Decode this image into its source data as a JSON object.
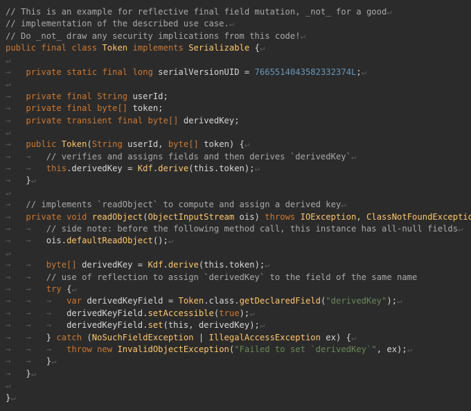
{
  "editor": {
    "lines": [
      [
        {
          "t": "// This is an example for reflective final field mutation, _not_ for a good",
          "c": "comment"
        },
        {
          "t": "↵",
          "c": "eol"
        }
      ],
      [
        {
          "t": "// implementation of the described use case.",
          "c": "comment"
        },
        {
          "t": "↵",
          "c": "eol"
        }
      ],
      [
        {
          "t": "// Do _not_ draw any security implications from this code!",
          "c": "comment"
        },
        {
          "t": "↵",
          "c": "eol"
        }
      ],
      [
        {
          "t": "public ",
          "c": "kw"
        },
        {
          "t": "final ",
          "c": "kw"
        },
        {
          "t": "class ",
          "c": "kw"
        },
        {
          "t": "Token",
          "c": "type"
        },
        {
          "t": " implements ",
          "c": "kw"
        },
        {
          "t": "Serializable",
          "c": "type"
        },
        {
          "t": " {",
          "c": "plain"
        },
        {
          "t": "↵",
          "c": "eol"
        }
      ],
      [
        {
          "t": "↵",
          "c": "eol"
        }
      ],
      [
        {
          "t": "→   ",
          "c": "tab"
        },
        {
          "t": "private ",
          "c": "kw"
        },
        {
          "t": "static ",
          "c": "kw"
        },
        {
          "t": "final ",
          "c": "kw"
        },
        {
          "t": "long ",
          "c": "kw"
        },
        {
          "t": "serialVersionUID = ",
          "c": "plain"
        },
        {
          "t": "7665514043582332374L",
          "c": "num"
        },
        {
          "t": ";",
          "c": "plain"
        },
        {
          "t": "↵",
          "c": "eol"
        }
      ],
      [
        {
          "t": "↵",
          "c": "eol"
        }
      ],
      [
        {
          "t": "→   ",
          "c": "tab"
        },
        {
          "t": "private ",
          "c": "kw"
        },
        {
          "t": "final ",
          "c": "kw"
        },
        {
          "t": "String ",
          "c": "kw"
        },
        {
          "t": "userId;",
          "c": "plain"
        }
      ],
      [
        {
          "t": "→   ",
          "c": "tab"
        },
        {
          "t": "private ",
          "c": "kw"
        },
        {
          "t": "final ",
          "c": "kw"
        },
        {
          "t": "byte[] ",
          "c": "kw"
        },
        {
          "t": "token;",
          "c": "plain"
        }
      ],
      [
        {
          "t": "→   ",
          "c": "tab"
        },
        {
          "t": "private ",
          "c": "kw"
        },
        {
          "t": "transient ",
          "c": "kw"
        },
        {
          "t": "final ",
          "c": "kw"
        },
        {
          "t": "byte[] ",
          "c": "kw"
        },
        {
          "t": "derivedKey;",
          "c": "plain"
        }
      ],
      [
        {
          "t": "↵",
          "c": "eol"
        }
      ],
      [
        {
          "t": "→   ",
          "c": "tab"
        },
        {
          "t": "public ",
          "c": "kw"
        },
        {
          "t": "Token",
          "c": "type"
        },
        {
          "t": "(",
          "c": "plain"
        },
        {
          "t": "String ",
          "c": "kw"
        },
        {
          "t": "userId, ",
          "c": "plain"
        },
        {
          "t": "byte[] ",
          "c": "kw"
        },
        {
          "t": "token) {",
          "c": "plain"
        },
        {
          "t": "↵",
          "c": "eol"
        }
      ],
      [
        {
          "t": "→   →   ",
          "c": "tab"
        },
        {
          "t": "// verifies and assigns fields and then derives `derivedKey`",
          "c": "comment"
        },
        {
          "t": "↵",
          "c": "eol"
        }
      ],
      [
        {
          "t": "→   →   ",
          "c": "tab"
        },
        {
          "t": "this",
          "c": "kw"
        },
        {
          "t": ".derivedKey = ",
          "c": "plain"
        },
        {
          "t": "Kdf",
          "c": "type"
        },
        {
          "t": ".",
          "c": "plain"
        },
        {
          "t": "derive",
          "c": "fn"
        },
        {
          "t": "(this.token);",
          "c": "plain"
        },
        {
          "t": "↵",
          "c": "eol"
        }
      ],
      [
        {
          "t": "→   ",
          "c": "tab"
        },
        {
          "t": "}",
          "c": "plain"
        },
        {
          "t": "↵",
          "c": "eol"
        }
      ],
      [
        {
          "t": "↵",
          "c": "eol"
        }
      ],
      [
        {
          "t": "→   ",
          "c": "tab"
        },
        {
          "t": "// implements `readObject` to compute and assign a derived key",
          "c": "comment"
        },
        {
          "t": "↵",
          "c": "eol"
        }
      ],
      [
        {
          "t": "→   ",
          "c": "tab"
        },
        {
          "t": "private ",
          "c": "kw"
        },
        {
          "t": "void ",
          "c": "kw"
        },
        {
          "t": "readObject",
          "c": "fn"
        },
        {
          "t": "(",
          "c": "plain"
        },
        {
          "t": "ObjectInputStream ",
          "c": "type"
        },
        {
          "t": "ois) ",
          "c": "plain"
        },
        {
          "t": "throws ",
          "c": "kw"
        },
        {
          "t": "IOException",
          "c": "type"
        },
        {
          "t": ", ",
          "c": "plain"
        },
        {
          "t": "ClassNotFoundException",
          "c": "type"
        },
        {
          "t": " {",
          "c": "plain"
        },
        {
          "t": "↵",
          "c": "eol"
        }
      ],
      [
        {
          "t": "→   →   ",
          "c": "tab"
        },
        {
          "t": "// side note: before the following method call, this instance has all-null fields",
          "c": "comment"
        },
        {
          "t": "↵",
          "c": "eol"
        }
      ],
      [
        {
          "t": "→   →   ",
          "c": "tab"
        },
        {
          "t": "ois.",
          "c": "plain"
        },
        {
          "t": "defaultReadObject",
          "c": "fn"
        },
        {
          "t": "();",
          "c": "plain"
        },
        {
          "t": "↵",
          "c": "eol"
        }
      ],
      [
        {
          "t": "↵",
          "c": "eol"
        }
      ],
      [
        {
          "t": "→   →   ",
          "c": "tab"
        },
        {
          "t": "byte[] ",
          "c": "kw"
        },
        {
          "t": "derivedKey = ",
          "c": "plain"
        },
        {
          "t": "Kdf",
          "c": "type"
        },
        {
          "t": ".",
          "c": "plain"
        },
        {
          "t": "derive",
          "c": "fn"
        },
        {
          "t": "(this.token);",
          "c": "plain"
        },
        {
          "t": "↵",
          "c": "eol"
        }
      ],
      [
        {
          "t": "→   →   ",
          "c": "tab"
        },
        {
          "t": "// use of reflection to assign `derivedKey` to the field of the same name",
          "c": "comment"
        }
      ],
      [
        {
          "t": "→   →   ",
          "c": "tab"
        },
        {
          "t": "try ",
          "c": "kw"
        },
        {
          "t": "{",
          "c": "plain"
        },
        {
          "t": "↵",
          "c": "eol"
        }
      ],
      [
        {
          "t": "→   →   →   ",
          "c": "tab"
        },
        {
          "t": "var ",
          "c": "kw"
        },
        {
          "t": "derivedKeyField = ",
          "c": "plain"
        },
        {
          "t": "Token",
          "c": "type"
        },
        {
          "t": ".class.",
          "c": "plain"
        },
        {
          "t": "getDeclaredField",
          "c": "fn"
        },
        {
          "t": "(",
          "c": "plain"
        },
        {
          "t": "\"derivedKey\"",
          "c": "str"
        },
        {
          "t": ");",
          "c": "plain"
        },
        {
          "t": "↵",
          "c": "eol"
        }
      ],
      [
        {
          "t": "→   →   →   ",
          "c": "tab"
        },
        {
          "t": "derivedKeyField.",
          "c": "plain"
        },
        {
          "t": "setAccessible",
          "c": "fn"
        },
        {
          "t": "(",
          "c": "plain"
        },
        {
          "t": "true",
          "c": "kw"
        },
        {
          "t": ");",
          "c": "plain"
        },
        {
          "t": "↵",
          "c": "eol"
        }
      ],
      [
        {
          "t": "→   →   →   ",
          "c": "tab"
        },
        {
          "t": "derivedKeyField.",
          "c": "plain"
        },
        {
          "t": "set",
          "c": "fn"
        },
        {
          "t": "(this, derivedKey);",
          "c": "plain"
        },
        {
          "t": "↵",
          "c": "eol"
        }
      ],
      [
        {
          "t": "→   →   ",
          "c": "tab"
        },
        {
          "t": "} ",
          "c": "plain"
        },
        {
          "t": "catch ",
          "c": "kw"
        },
        {
          "t": "(",
          "c": "plain"
        },
        {
          "t": "NoSuchFieldException",
          "c": "type"
        },
        {
          "t": " | ",
          "c": "plain"
        },
        {
          "t": "IllegalAccessException",
          "c": "type"
        },
        {
          "t": " ex) {",
          "c": "plain"
        },
        {
          "t": "↵",
          "c": "eol"
        }
      ],
      [
        {
          "t": "→   →   →   ",
          "c": "tab"
        },
        {
          "t": "throw ",
          "c": "kw"
        },
        {
          "t": "new ",
          "c": "kw"
        },
        {
          "t": "InvalidObjectException",
          "c": "type"
        },
        {
          "t": "(",
          "c": "plain"
        },
        {
          "t": "\"Failed to set `derivedKey`\"",
          "c": "str"
        },
        {
          "t": ", ex);",
          "c": "plain"
        },
        {
          "t": "↵",
          "c": "eol"
        }
      ],
      [
        {
          "t": "→   →   ",
          "c": "tab"
        },
        {
          "t": "}",
          "c": "plain"
        },
        {
          "t": "↵",
          "c": "eol"
        }
      ],
      [
        {
          "t": "→   ",
          "c": "tab"
        },
        {
          "t": "}",
          "c": "plain"
        },
        {
          "t": "↵",
          "c": "eol"
        }
      ],
      [
        {
          "t": "↵",
          "c": "eol"
        }
      ],
      [
        {
          "t": "}",
          "c": "plain"
        },
        {
          "t": "↵",
          "c": "eol"
        }
      ]
    ]
  }
}
